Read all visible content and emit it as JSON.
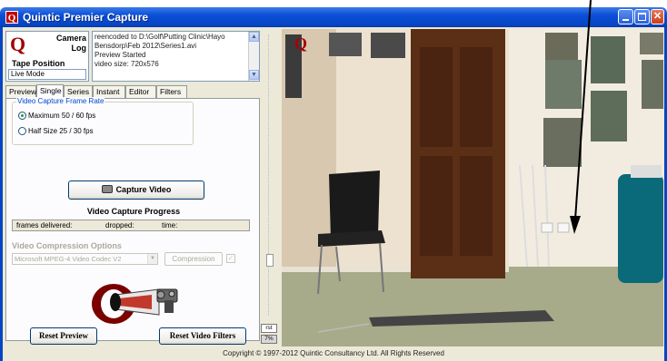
{
  "window": {
    "title": "Quintic Premier Capture",
    "logo_letter": "Q",
    "buttons": [
      "minimize",
      "maximize",
      "close"
    ],
    "close_glyph": "✕"
  },
  "header": {
    "camera_log_label": "Camera\nLog",
    "tape_position_label": "Tape Position",
    "mode_value": "Live Mode",
    "log_lines": [
      "reencoded to D:\\Golf\\Putting Clinic\\Hayo",
      "Bensdorp\\Feb 2012\\Series1.avi",
      "Preview Started",
      "video size: 720x576"
    ]
  },
  "tabs": [
    {
      "label": "Preview",
      "active": false
    },
    {
      "label": "Single",
      "active": true
    },
    {
      "label": "Series",
      "active": false
    },
    {
      "label": "Instant",
      "active": false
    },
    {
      "label": "Editor",
      "active": false
    },
    {
      "label": "Filters",
      "active": false
    }
  ],
  "frame_rate": {
    "title": "Video Capture Frame Rate",
    "options": [
      {
        "label": "Maximum  50 / 60 fps",
        "checked": true
      },
      {
        "label": "Half Size  25 / 30 fps",
        "checked": false
      }
    ]
  },
  "capture_button": "Capture Video",
  "progress": {
    "title": "Video Capture Progress",
    "frames_label": "frames delivered:",
    "dropped_label": "dropped:",
    "time_label": "time:"
  },
  "compression": {
    "title": "Video Compression Options",
    "codec": "Microsoft MPEG-4 Video Codec V2",
    "button": "Compression",
    "checked": true
  },
  "reset_preview": "Reset Preview",
  "reset_filters": "Reset Video Filters",
  "splitter": {
    "rst_label": "rst",
    "zoom_label": "7%"
  },
  "footer": "Copyright © 1997-2012  Quintic Consultancy Ltd.  All Rights Reserved",
  "colors": {
    "titlebar": "#0645c4",
    "panel": "#ece9d8",
    "logo_red": "#a00000",
    "group_title": "#0046d5"
  }
}
